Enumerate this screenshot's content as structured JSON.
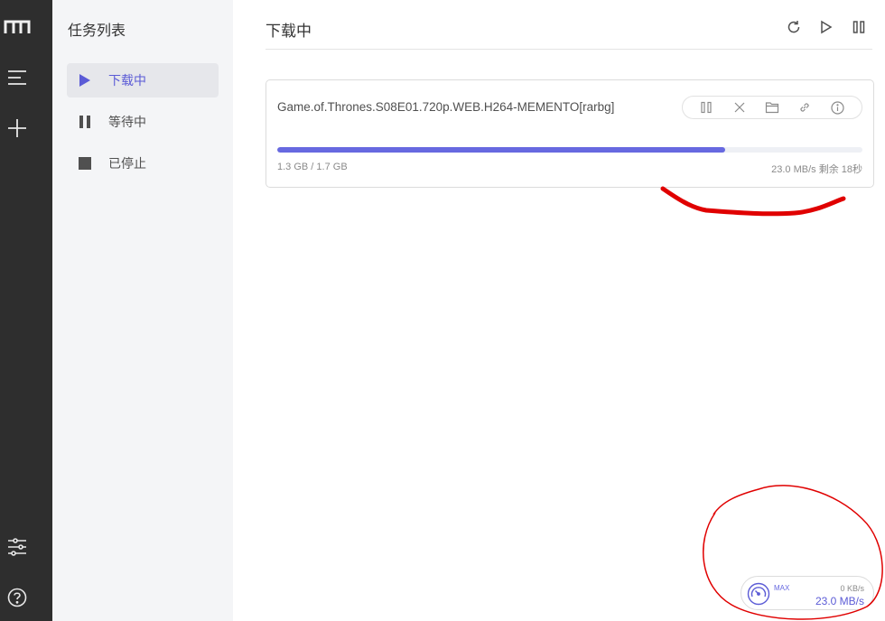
{
  "rail": {
    "items": [
      {
        "icon": "logo-icon"
      },
      {
        "icon": "task-list-icon"
      },
      {
        "icon": "add-task-icon"
      },
      {
        "icon": "preferences-icon"
      },
      {
        "icon": "help-icon"
      }
    ]
  },
  "sidebar": {
    "title": "任务列表",
    "items": [
      {
        "label": "下载中",
        "icon": "play-icon",
        "active": true
      },
      {
        "label": "等待中",
        "icon": "pause-icon",
        "active": false
      },
      {
        "label": "已停止",
        "icon": "stop-icon",
        "active": false
      }
    ]
  },
  "main": {
    "title": "下载中",
    "toolbar": [
      {
        "icon": "refresh-icon"
      },
      {
        "icon": "resume-all-icon"
      },
      {
        "icon": "pause-all-icon"
      }
    ]
  },
  "task": {
    "name": "Game.of.Thrones.S08E01.720p.WEB.H264-MEMENTO[rarbg]",
    "progress": 0.765,
    "size": "1.3 GB / 1.7 GB",
    "speed": "23.0 MB/s 剩余 18秒",
    "actions": [
      {
        "icon": "pause-icon"
      },
      {
        "icon": "delete-icon"
      },
      {
        "icon": "folder-icon"
      },
      {
        "icon": "link-icon"
      },
      {
        "icon": "info-icon"
      }
    ]
  },
  "speedometer": {
    "max_label": "MAX",
    "upload": "0 KB/s",
    "download": "23.0 MB/s"
  },
  "colors": {
    "accent": "#5b5bd6",
    "rail": "#2e2e2e",
    "sidebar": "#f4f5f7",
    "annotation": "#e00000"
  }
}
